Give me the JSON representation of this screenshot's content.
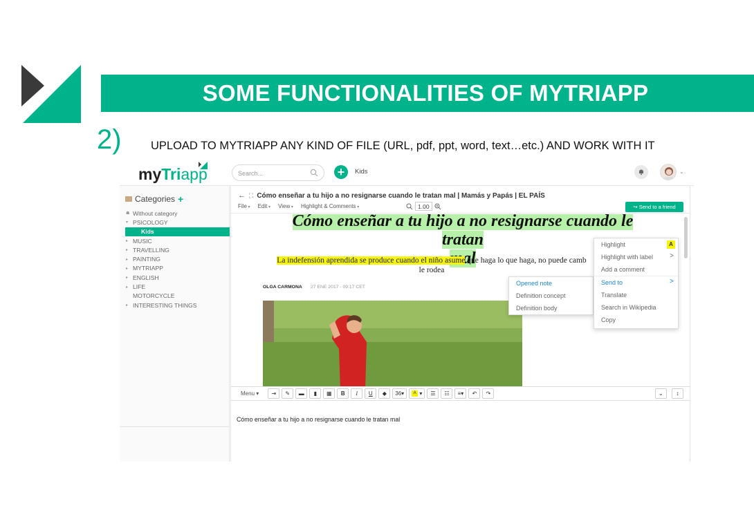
{
  "slide": {
    "title": "SOME FUNCTIONALITIES OF MYTRIAPP",
    "step_number": "2)",
    "subtitle": "UPLOAD TO MYTRIAPP ANY KIND OF FILE (URL, pdf, ppt, word, text…etc.) AND WORK WITH IT",
    "accent_color": "#01b38b"
  },
  "app": {
    "brand_my": "my",
    "brand_tri": "Tri",
    "brand_app": "app",
    "search_placeholder": "Search...",
    "breadcrumb": "Kids",
    "icons": [
      "search-icon",
      "add-icon",
      "bell-icon",
      "avatar",
      "folder-icon"
    ]
  },
  "sidebar": {
    "header": "Categories",
    "add_symbol": "+",
    "items": [
      {
        "label": "Without category",
        "caret": "",
        "prefix": "☗"
      },
      {
        "label": "PSICOLOGY",
        "caret": "▾"
      },
      {
        "label": "Kids",
        "selected": true
      },
      {
        "label": "MUSIC",
        "caret": "▸"
      },
      {
        "label": "TRAVELLING",
        "caret": "▸"
      },
      {
        "label": "PAINTING",
        "caret": "▸"
      },
      {
        "label": "MYTRIAPP",
        "caret": "▸"
      },
      {
        "label": "ENGLISH",
        "caret": "▸"
      },
      {
        "label": "LIFE",
        "caret": "▸"
      },
      {
        "label": "MOTORCYCLE",
        "caret": ""
      },
      {
        "label": "INTERESTING THINGS",
        "caret": "▸"
      }
    ]
  },
  "document": {
    "title": "Cómo enseñar a tu hijo a no resignarse cuando le tratan mal | Mamás y Papás | EL PAÍS",
    "menu": [
      "File",
      "Edit",
      "View",
      "Highlight & Comments"
    ],
    "zoom": "1.00",
    "send_button": "Send to a friend",
    "article_title_line1": "Cómo enseñar a tu hijo a no resignarse cuando le tratan",
    "article_title_line2": "mal",
    "article_sub_highlight": "La indefensión aprendida se produce cuando el niño asume",
    "article_sub_rest": " que haga lo que haga, no puede camb",
    "article_sub_line2": "le rodea",
    "author": "OLGA CARMONA",
    "date": "27 ENE 2017 - 09:17 CET"
  },
  "context_menu": {
    "items": [
      {
        "label": "Highlight",
        "badge": "A"
      },
      {
        "label": "Highlight with label",
        "chevron": ">"
      },
      {
        "label": "Add a comment"
      },
      {
        "label": "Send to",
        "chevron": ">"
      },
      {
        "label": "Translate"
      },
      {
        "label": "Search in Wikipedia"
      },
      {
        "label": "Copy"
      }
    ]
  },
  "submenu": {
    "items": [
      {
        "label": "Opened note"
      },
      {
        "label": "Definition concept"
      },
      {
        "label": "Definition body"
      }
    ]
  },
  "editor": {
    "menu_label": "Menu",
    "font_size": "36",
    "highlight_letter": "A",
    "content": "Cómo enseñar a tu hijo a no resignarse cuando le tratan mal"
  }
}
